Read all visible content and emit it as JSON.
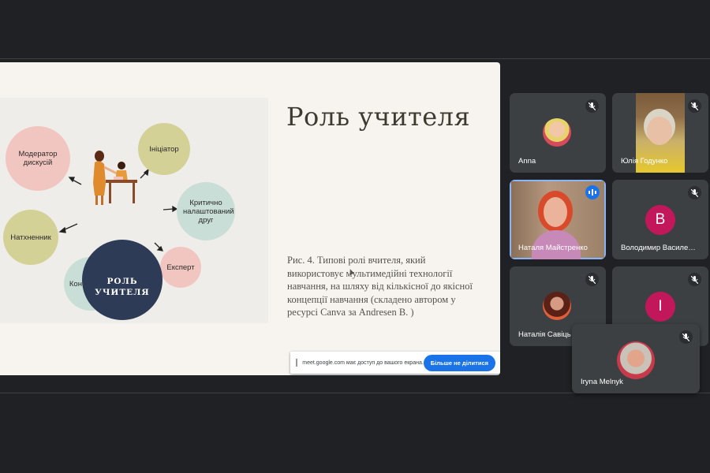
{
  "slide": {
    "title": "Роль учителя",
    "center_label": "РОЛЬ УЧИТЕЛЯ",
    "roles": {
      "moderator": "Модератор дискусій",
      "initiator": "Ініціатор",
      "friend": "Критично налаштований друг",
      "inspirer": "Натхненник",
      "expert": "Експерт",
      "consultant": "Консультант"
    },
    "caption": "Рис. 4. Типові ролі вчителя, який використовує мультимедійні технології навчання, на шляху від кількісної до якісної концепції навчання (складено автором у ресурсі Canva за Andresen B. )",
    "colors": {
      "pink": "#f2c6c0",
      "olive": "#d4d197",
      "mint": "#c9ded6",
      "navy": "#2e3b56"
    }
  },
  "share_bar": {
    "message": "meet.google.com має доступ до вашого екрана.",
    "stop_label": "Більше не ділитися"
  },
  "participants": [
    {
      "name": "Anna",
      "avatar": "photo",
      "mic": "muted"
    },
    {
      "name": "Юлія Годунко",
      "avatar": "video",
      "mic": "muted"
    },
    {
      "name": "Наталя Майстренко",
      "avatar": "video",
      "mic": "speaking"
    },
    {
      "name": "Володимир Василе…",
      "avatar": "B",
      "mic": "muted"
    },
    {
      "name": "Наталія Савіць",
      "avatar": "photo",
      "mic": "muted"
    },
    {
      "name": "",
      "avatar": "I",
      "mic": "muted"
    },
    {
      "name": "Iryna Melnyk",
      "avatar": "photo",
      "mic": "muted"
    }
  ]
}
